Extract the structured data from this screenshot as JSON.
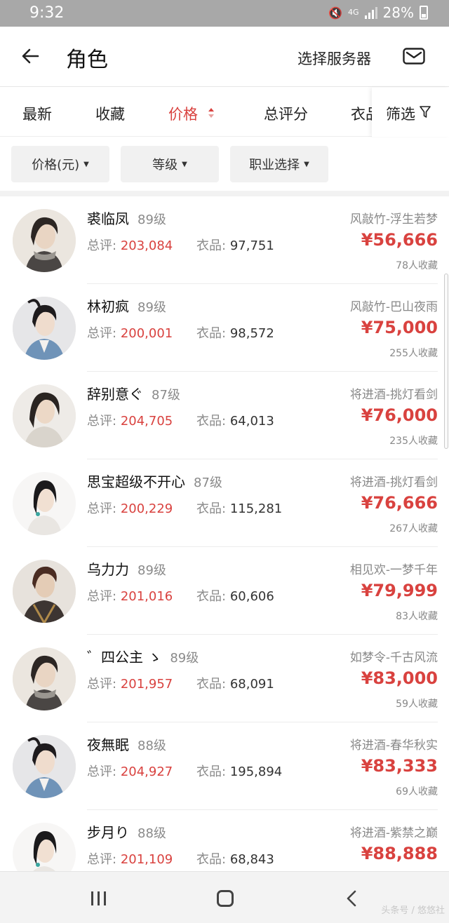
{
  "status_bar": {
    "time": "9:32",
    "network": "4G",
    "battery": "28%"
  },
  "header": {
    "title": "角色",
    "server_select": "选择服务器"
  },
  "sort_tabs": [
    {
      "label": "最新"
    },
    {
      "label": "收藏"
    },
    {
      "label": "价格"
    },
    {
      "label": "总评分"
    },
    {
      "label": "衣品"
    }
  ],
  "filter_label": "筛选",
  "filters": [
    {
      "label": "价格(元)"
    },
    {
      "label": "等级"
    },
    {
      "label": "职业选择"
    }
  ],
  "labels": {
    "score": "总评:",
    "outfit": "衣品:"
  },
  "characters": [
    {
      "name": "裘临凤",
      "level": "89级",
      "score": "203,084",
      "outfit": "97,751",
      "server": "风敲竹-浮生若梦",
      "price": "¥56,666",
      "favorites": "78人收藏"
    },
    {
      "name": "林初疯",
      "level": "89级",
      "score": "200,001",
      "outfit": "98,572",
      "server": "风敲竹-巴山夜雨",
      "price": "¥75,000",
      "favorites": "255人收藏"
    },
    {
      "name": "辞别意ぐ",
      "level": "87级",
      "score": "204,705",
      "outfit": "64,013",
      "server": "将进酒-挑灯看剑",
      "price": "¥76,000",
      "favorites": "235人收藏"
    },
    {
      "name": "思宝超级不开心",
      "level": "87级",
      "score": "200,229",
      "outfit": "115,281",
      "server": "将进酒-挑灯看剑",
      "price": "¥76,666",
      "favorites": "267人收藏"
    },
    {
      "name": "乌力力",
      "level": "89级",
      "score": "201,016",
      "outfit": "60,606",
      "server": "相见欢-一梦千年",
      "price": "¥79,999",
      "favorites": "83人收藏"
    },
    {
      "name": "゛四公主 ゝ",
      "level": "89级",
      "score": "201,957",
      "outfit": "68,091",
      "server": "如梦令-千古风流",
      "price": "¥83,000",
      "favorites": "59人收藏"
    },
    {
      "name": "夜無眠",
      "level": "88级",
      "score": "204,927",
      "outfit": "195,894",
      "server": "将进酒-春华秋实",
      "price": "¥83,333",
      "favorites": "69人收藏"
    },
    {
      "name": "步月り",
      "level": "88级",
      "score": "201,109",
      "outfit": "68,843",
      "server": "将进酒-紫禁之巅",
      "price": "¥88,888",
      "favorites": ""
    }
  ],
  "watermark": "头条号 / 悠悠社",
  "colors": {
    "accent": "#d9423f",
    "status_bar": "#a8a8a8",
    "chip_bg": "#f1f1f1"
  }
}
